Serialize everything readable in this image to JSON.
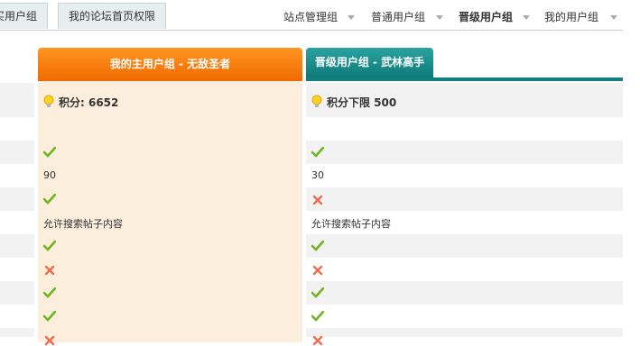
{
  "tabs": [
    {
      "label": "购买用户组"
    },
    {
      "label": "我的论坛首页权限"
    }
  ],
  "nav": [
    {
      "label": "站点管理组"
    },
    {
      "label": "普通用户组"
    },
    {
      "label": "晋级用户组"
    },
    {
      "label": "我的用户组"
    }
  ],
  "groups": {
    "mine_header": "我的主用户组 - 无敌圣者",
    "pro_header": "晋级用户组 - 武林高手"
  },
  "points": {
    "mine": "积分: 6652",
    "pro": "积分下限 500"
  },
  "rows": [
    {
      "mine": "yes",
      "pro": "yes"
    },
    {
      "mine": "90",
      "pro": "30"
    },
    {
      "mine": "yes",
      "pro": "no"
    },
    {
      "mine": "允许搜索帖子内容",
      "pro": "允许搜索帖子内容"
    },
    {
      "mine": "yes",
      "pro": "yes"
    },
    {
      "mine": "no",
      "pro": "no"
    },
    {
      "mine": "yes",
      "pro": "yes"
    },
    {
      "mine": "yes",
      "pro": "yes"
    },
    {
      "mine": "no",
      "pro": "no"
    }
  ],
  "colors": {
    "accent_orange": "#f47e0c",
    "accent_teal": "#177f7e",
    "yes": "#6fb51e",
    "no": "#f26b4d"
  }
}
